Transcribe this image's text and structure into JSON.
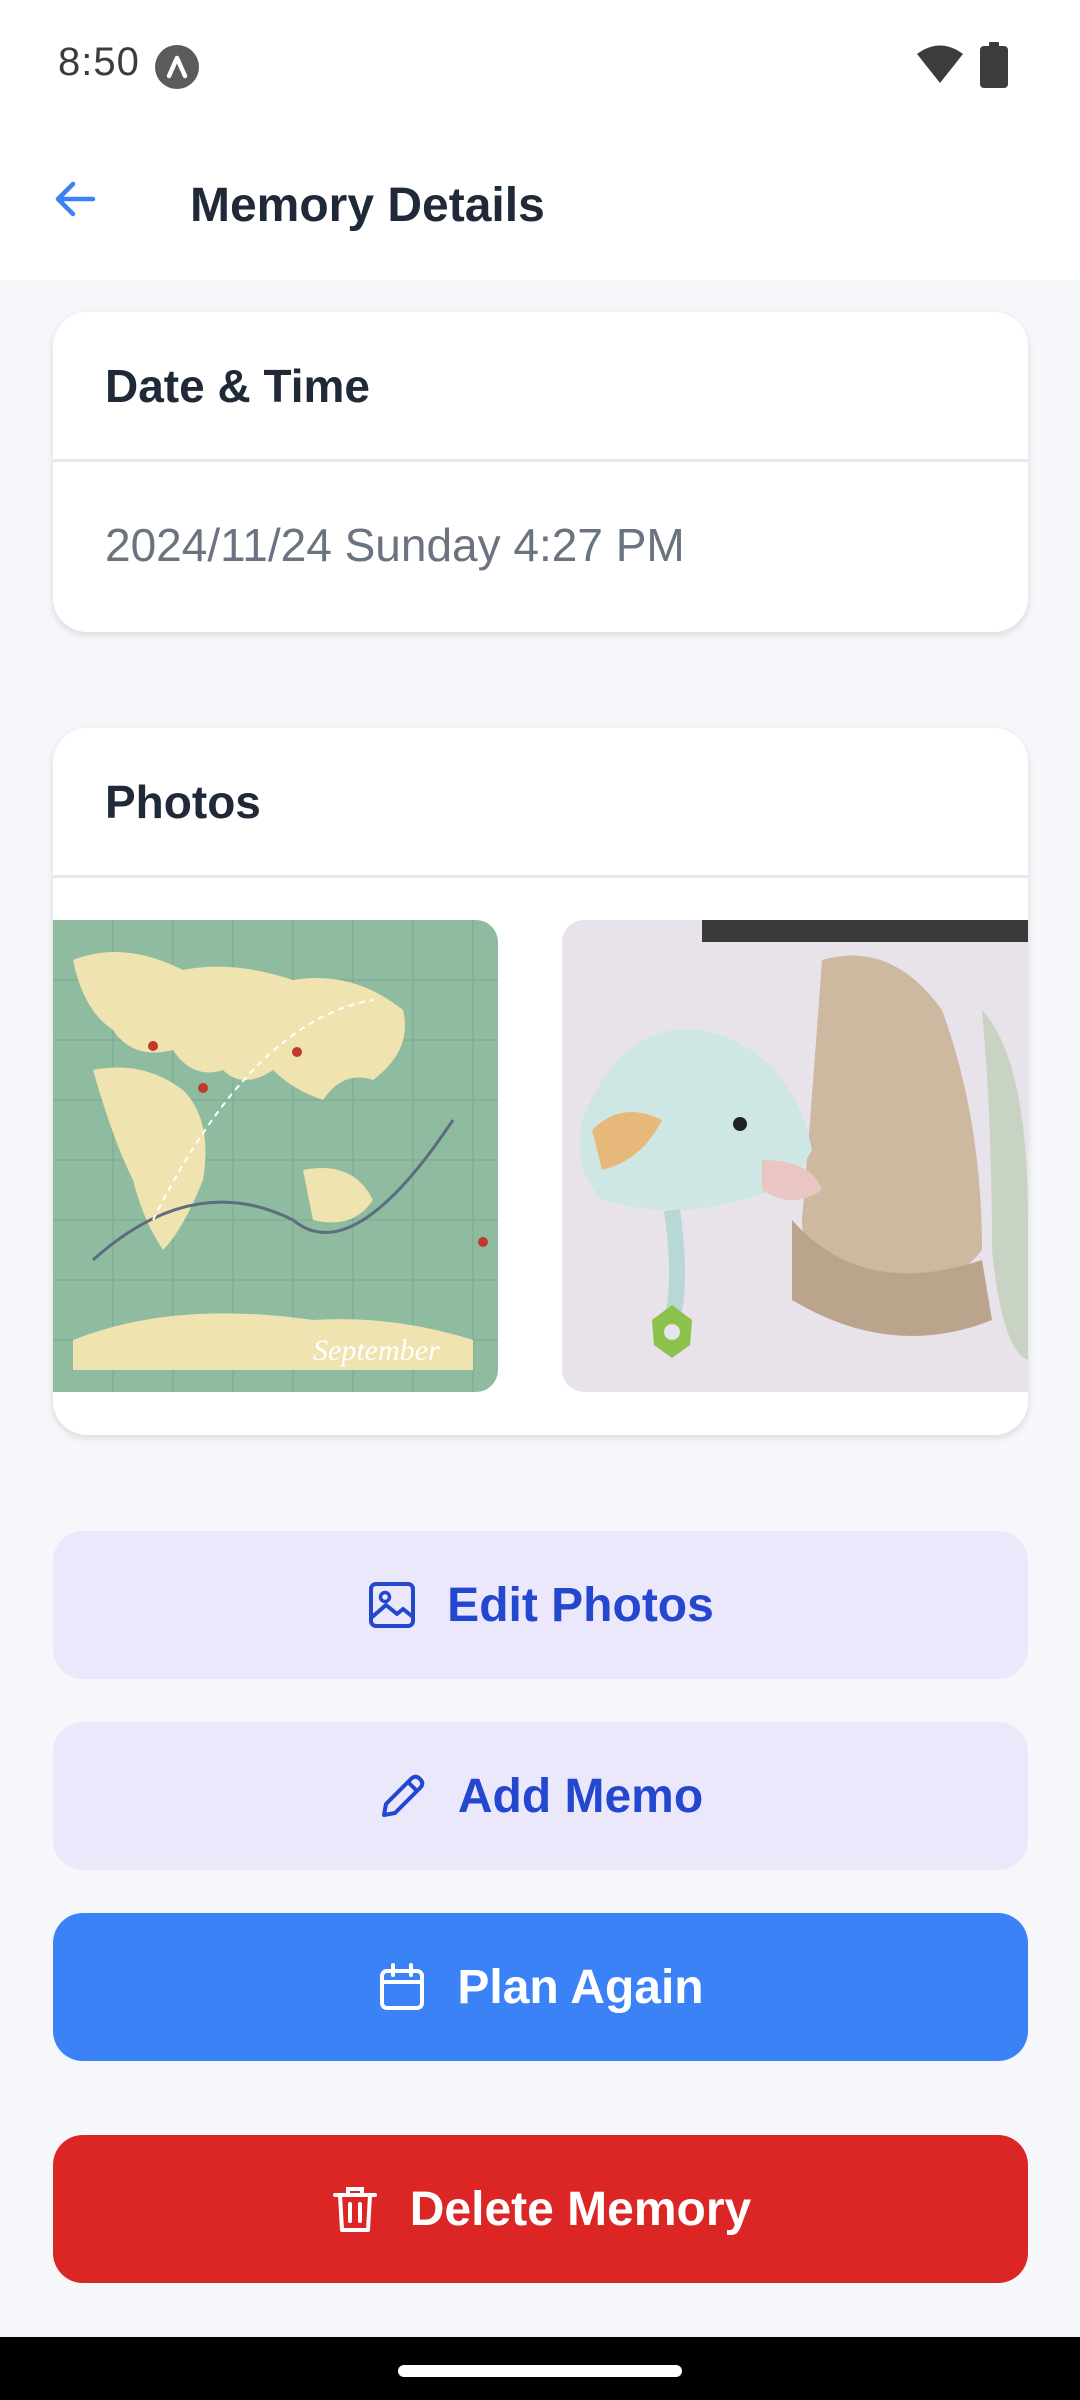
{
  "status_bar": {
    "time": "8:50",
    "icons": [
      "app-notification-icon",
      "wifi-icon",
      "battery-icon"
    ]
  },
  "app_bar": {
    "title": "Memory Details",
    "back_icon": "arrow-left-icon"
  },
  "date_card": {
    "header": "Date & Time",
    "value": "2024/11/24 Sunday 4:27 PM"
  },
  "photos_card": {
    "header": "Photos",
    "photos": [
      {
        "subject": "world-map-calendar-photo",
        "caption": "September"
      },
      {
        "subject": "plush-dolphin-and-hats-photo"
      }
    ]
  },
  "actions": {
    "edit_photos": {
      "label": "Edit Photos",
      "icon": "image-icon"
    },
    "add_memo": {
      "label": "Add Memo",
      "icon": "pencil-icon"
    },
    "plan_again": {
      "label": "Plan Again",
      "icon": "calendar-icon"
    },
    "delete_memory": {
      "label": "Delete Memory",
      "icon": "trash-icon"
    }
  },
  "colors": {
    "accent_blue": "#3b82f6",
    "soft_button_bg": "#ebe8fb",
    "soft_button_text": "#2447cf",
    "danger": "#dc2626",
    "background": "#f6f7fa"
  }
}
